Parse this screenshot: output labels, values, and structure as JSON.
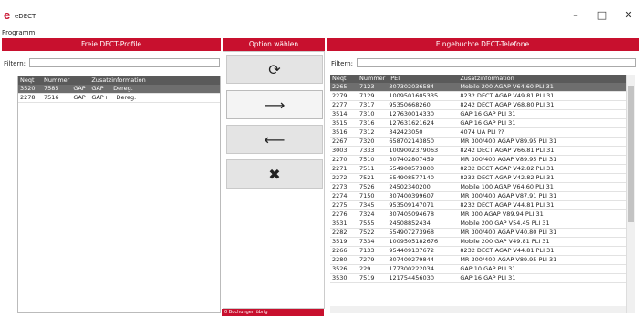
{
  "window": {
    "title": "eDECT",
    "logo": "e"
  },
  "menu": {
    "programm": "Programm"
  },
  "left": {
    "header": "Freie DECT-Profile",
    "filter_label": "Filtern:",
    "columns": [
      "Neqt",
      "Nummer",
      "",
      "Zusatzinformation"
    ],
    "rows": [
      [
        "3520",
        "7585",
        "GAP",
        "GAP",
        "Dereg."
      ],
      [
        "2278",
        "7516",
        "GAP",
        "GAP+",
        "Dereg."
      ]
    ]
  },
  "middle": {
    "header": "Option wählen",
    "buttons": {
      "refresh": "⟳",
      "right": "⟶",
      "left": "⟵",
      "delete": "✖"
    },
    "status": "0 Buchungen übrig"
  },
  "right": {
    "header": "Eingebuchte DECT-Telefone",
    "filter_label": "Filtern:",
    "columns": [
      "Neqt",
      "Nummer",
      "IPEI",
      "Zusatzinformation"
    ],
    "rows": [
      [
        "2265",
        "7123",
        "307302036584",
        "Mobile 200  AGAP  V64.60  PLI 31"
      ],
      [
        "2279",
        "7129",
        "1009501605335",
        "8232 DECT  AGAP  V49.81  PLI 31"
      ],
      [
        "2277",
        "7317",
        "95350668260",
        "8242 DECT  AGAP  V68.80  PLI 31"
      ],
      [
        "3514",
        "7310",
        "127630014330",
        "GAP 16    GAP        PLI 31"
      ],
      [
        "3515",
        "7316",
        "127631621624",
        "GAP 16    GAP        PLI 31"
      ],
      [
        "3516",
        "7312",
        "342423050",
        "4074     UA         PLI ??"
      ],
      [
        "2267",
        "7320",
        "658702143850",
        "MR 300/400  AGAP  V89.95  PLI 31"
      ],
      [
        "3003",
        "7333",
        "1009002379063",
        "8242 DECT  AGAP  V66.81  PLI 31"
      ],
      [
        "2270",
        "7510",
        "307402807459",
        "MR 300/400  AGAP  V89.95  PLI 31"
      ],
      [
        "2271",
        "7511",
        "554908573800",
        "8232 DECT  AGAP  V42.82  PLI 31"
      ],
      [
        "2272",
        "7521",
        "554908577140",
        "8232 DECT  AGAP  V42.82  PLI 31"
      ],
      [
        "2273",
        "7526",
        "24502340200",
        "Mobile 100  AGAP  V64.60  PLI 31"
      ],
      [
        "2274",
        "7150",
        "307400399607",
        "MR 300/400  AGAP  V87.91  PLI 31"
      ],
      [
        "2275",
        "7345",
        "953509147071",
        "8232 DECT  AGAP  V44.81  PLI 31"
      ],
      [
        "2276",
        "7324",
        "307405094678",
        "MR 300    AGAP  V89.94  PLI 31"
      ],
      [
        "3531",
        "7555",
        "24508852434",
        "Mobile 200  GAP  V54.45  PLI 31"
      ],
      [
        "2282",
        "7522",
        "554907273968",
        "MR 300/400  AGAP  V40.80  PLI 31"
      ],
      [
        "3519",
        "7334",
        "1009505182676",
        "Mobile 200  GAP  V49.81  PLI 31"
      ],
      [
        "2266",
        "7133",
        "954409137672",
        "8232 DECT  AGAP  V44.81  PLI 31"
      ],
      [
        "2280",
        "7279",
        "307409279844",
        "MR 300/400  AGAP  V89.95  PLI 31"
      ],
      [
        "3526",
        "229",
        "177300222034",
        "GAP 10    GAP        PLI 31"
      ],
      [
        "3530",
        "7519",
        "121754456030",
        "GAP 16    GAP        PLI 31"
      ]
    ]
  }
}
